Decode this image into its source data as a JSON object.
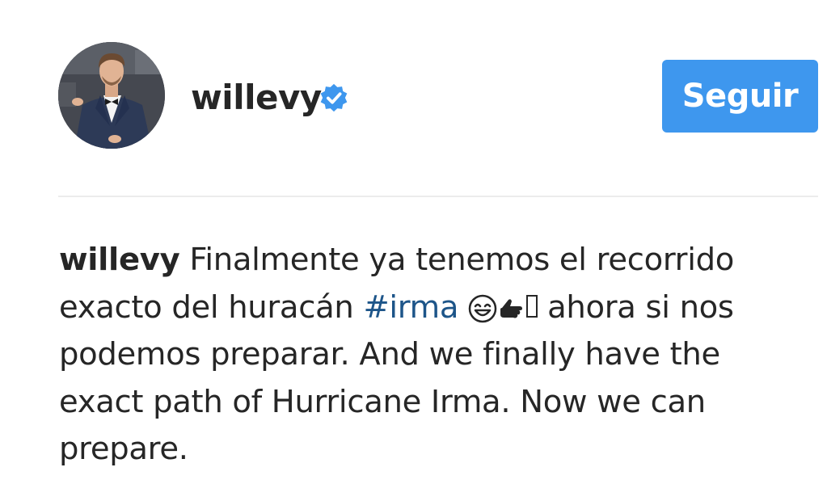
{
  "post_header": {
    "username": "willevy",
    "verified": true,
    "follow_label": "Seguir",
    "accent_color": "#3e97ee"
  },
  "caption": {
    "username": "willevy",
    "text_before_hashtag": "Finalmente ya tenemos el recorrido exacto del huracán",
    "hashtag": "#irma",
    "emoji_icons": [
      "smiling-face-icon",
      "pointing-hand-icon",
      "missing-glyph"
    ],
    "text_after_emoji": "ahora si nos podemos preparar. And we finally have the exact path of Hurricane Irma. Now we can prepare.",
    "hashtag_color": "#1d5589"
  }
}
